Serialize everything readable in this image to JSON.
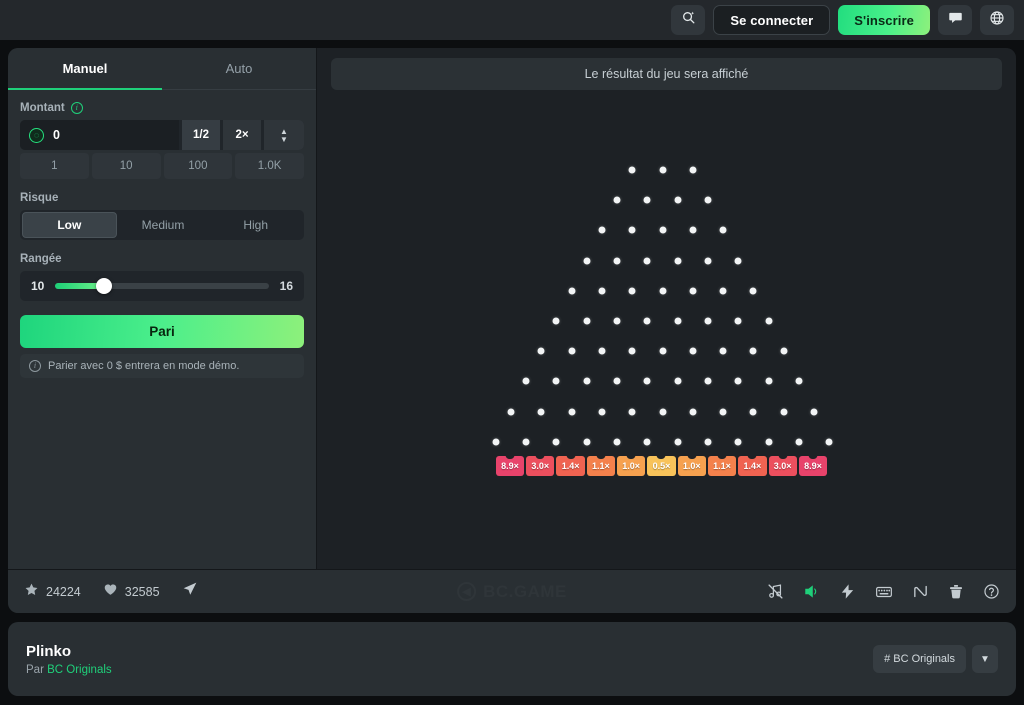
{
  "topbar": {
    "search_icon": "search-icon",
    "login_label": "Se connecter",
    "signup_label": "S'inscrire",
    "chat_icon": "chat-bubble-icon",
    "language_icon": "globe-icon"
  },
  "panel": {
    "tabs": [
      {
        "label": "Manuel",
        "active": true
      },
      {
        "label": "Auto",
        "active": false
      }
    ],
    "amount": {
      "label": "Montant",
      "info_icon": "info-icon",
      "coin_icon": "bc-coin-icon",
      "value": "0",
      "half_label": "1/2",
      "double_label": "2×",
      "stepper_icon": "stepper-up-down-icon",
      "quick_values": [
        "1",
        "10",
        "100",
        "1.0K"
      ]
    },
    "risk": {
      "label": "Risque",
      "options": [
        "Low",
        "Medium",
        "High"
      ],
      "selected": "Low"
    },
    "rows": {
      "label": "Rangée",
      "min": "10",
      "max": "16",
      "value": 10,
      "fill_percent": 23
    },
    "bet_button": "Pari",
    "demo_note": "Parier avec 0 $ entrera en mode démo.",
    "demo_note_icon": "info-icon"
  },
  "board": {
    "result_text": "Le résultat du jeu sera affiché",
    "peg_rows": [
      3,
      4,
      5,
      6,
      7,
      8,
      9,
      10,
      11,
      12
    ],
    "multipliers": [
      {
        "label": "8.9×",
        "color": "#e8436b"
      },
      {
        "label": "3.0×",
        "color": "#ec4f5e"
      },
      {
        "label": "1.4×",
        "color": "#f06351"
      },
      {
        "label": "1.1×",
        "color": "#f4814c"
      },
      {
        "label": "1.0×",
        "color": "#f6a14f"
      },
      {
        "label": "0.5×",
        "color": "#f8c35a"
      },
      {
        "label": "1.0×",
        "color": "#f6a14f"
      },
      {
        "label": "1.1×",
        "color": "#f4814c"
      },
      {
        "label": "1.4×",
        "color": "#f06351"
      },
      {
        "label": "3.0×",
        "color": "#ec4f5e"
      },
      {
        "label": "8.9×",
        "color": "#e8436b"
      }
    ]
  },
  "game_footer": {
    "star_icon": "star-icon",
    "star_count": "24224",
    "heart_icon": "heart-icon",
    "heart_count": "32585",
    "share_icon": "share-icon",
    "watermark": "BC.GAME",
    "tools": [
      {
        "icon": "music-off-icon",
        "active": false
      },
      {
        "icon": "sound-on-icon",
        "active": true
      },
      {
        "icon": "lightning-icon",
        "active": false
      },
      {
        "icon": "keyboard-icon",
        "active": false
      },
      {
        "icon": "trend-line-icon",
        "active": false
      },
      {
        "icon": "trash-icon",
        "active": false
      },
      {
        "icon": "help-icon",
        "active": false
      }
    ]
  },
  "bottom_card": {
    "title": "Plinko",
    "by_prefix": "Par ",
    "provider": "BC Originals",
    "tag": "# BC Originals",
    "chevron_icon": "chevron-down-icon"
  },
  "colors": {
    "accent_green": "#1fd07a",
    "panel_bg": "#292f33",
    "board_bg": "#1d2125"
  }
}
